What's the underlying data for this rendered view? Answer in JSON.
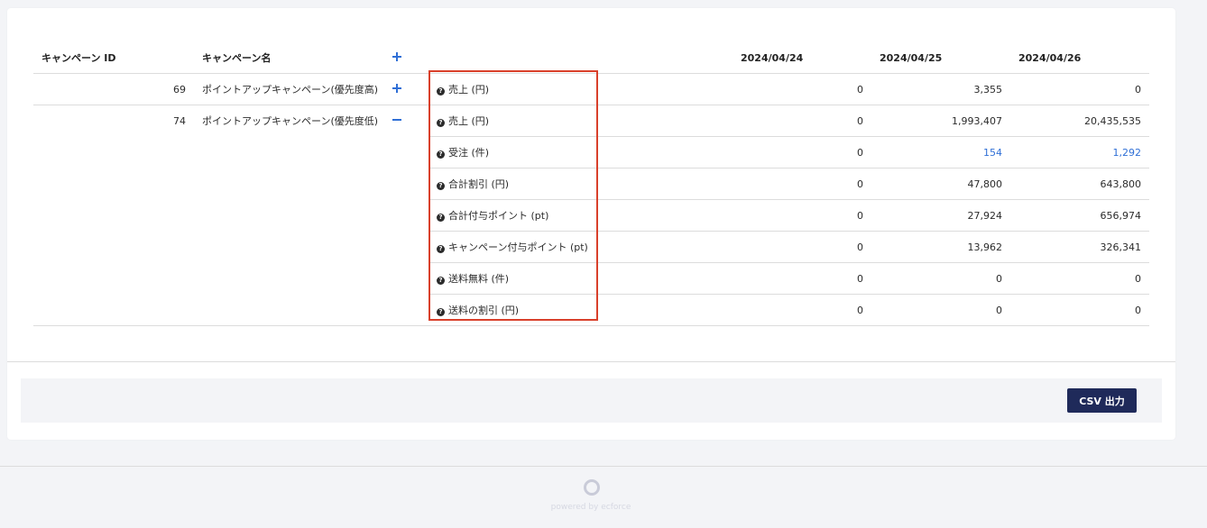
{
  "table": {
    "headers": {
      "campaign_id": "キャンペーン ID",
      "campaign_name": "キャンペーン名",
      "dates": [
        "2024/04/24",
        "2024/04/25",
        "2024/04/26"
      ]
    },
    "rows": [
      {
        "id": "69",
        "name": "ポイントアップキャンペーン(優先度高)",
        "expand_icon": "plus-icon",
        "metrics": [
          {
            "label": "売上 (円)",
            "values": [
              "0",
              "3,355",
              "0"
            ]
          }
        ]
      },
      {
        "id": "74",
        "name": "ポイントアップキャンペーン(優先度低)",
        "expand_icon": "minus-icon",
        "metrics": [
          {
            "label": "売上 (円)",
            "values": [
              "0",
              "1,993,407",
              "20,435,535"
            ]
          },
          {
            "label": "受注 (件)",
            "values": [
              "0",
              "154",
              "1,292"
            ]
          },
          {
            "label": "合計割引 (円)",
            "values": [
              "0",
              "47,800",
              "643,800"
            ]
          },
          {
            "label": "合計付与ポイント (pt)",
            "values": [
              "0",
              "27,924",
              "656,974"
            ]
          },
          {
            "label": "キャンペーン付与ポイント (pt)",
            "values": [
              "0",
              "13,962",
              "326,341"
            ]
          },
          {
            "label": "送料無料 (件)",
            "values": [
              "0",
              "0",
              "0"
            ]
          },
          {
            "label": "送料の割引 (円)",
            "values": [
              "0",
              "0",
              "0"
            ]
          }
        ]
      }
    ]
  },
  "footer": {
    "csv_button_label": "CSV 出力",
    "brand_text": "powered by ecforce"
  },
  "colors": {
    "accent": "#2f6fd6",
    "button": "#1f2a5a",
    "highlight": "#d9402b"
  }
}
